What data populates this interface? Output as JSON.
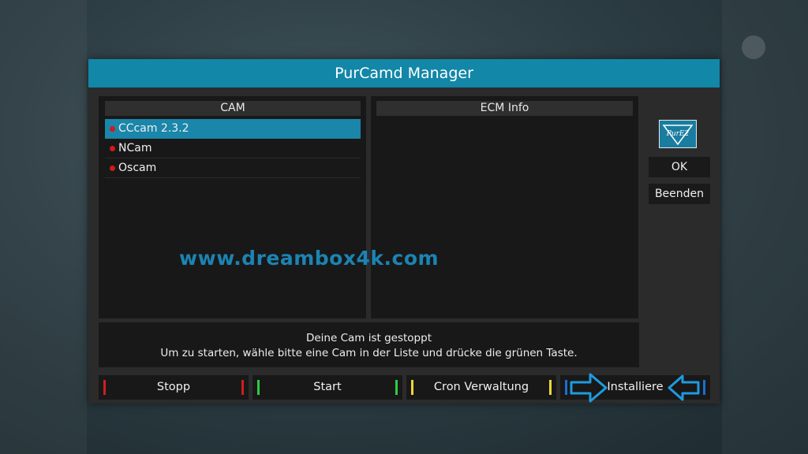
{
  "dialog": {
    "title": "PurCamd Manager"
  },
  "cam_panel": {
    "header": "CAM",
    "items": [
      {
        "label": "CCcam 2.3.2",
        "status_color": "#d11a1a",
        "selected": true
      },
      {
        "label": "NCam",
        "status_color": "#d11a1a",
        "selected": false
      },
      {
        "label": "Oscam",
        "status_color": "#d11a1a",
        "selected": false
      }
    ]
  },
  "ecm_panel": {
    "header": "ECM Info"
  },
  "side_buttons": {
    "ok_label": "OK",
    "exit_label": "Beenden"
  },
  "logo": {
    "icon": "purcamd-logo-icon",
    "text": "PurE2"
  },
  "watermark": "www.dreambox4k.com",
  "status": {
    "line1": "Deine Cam ist gestoppt",
    "line2": "Um zu starten, wähle bitte eine Cam in der Liste und drücke die grünen Taste."
  },
  "color_keys": [
    {
      "label": "Stopp",
      "color": "#cc1f1f"
    },
    {
      "label": "Start",
      "color": "#2ecc40"
    },
    {
      "label": "Cron Verwaltung",
      "color": "#f0d43a"
    },
    {
      "label": "Installiere",
      "color": "#1b6fd1"
    }
  ],
  "colors": {
    "accent": "#1287a8",
    "highlight": "#1a86aa",
    "watermark": "#1b84b3",
    "arrow": "#1e9be0"
  }
}
